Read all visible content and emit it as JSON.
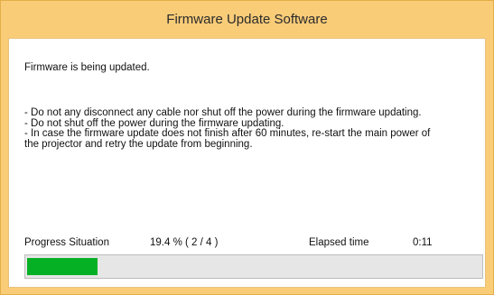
{
  "window": {
    "title": "Firmware Update Software"
  },
  "status": {
    "message": "Firmware is being updated."
  },
  "notes": [
    "- Do not any disconnect any cable nor shut off the power during the firmware updating.",
    "- Do not shut off the power during the firmware updating.",
    "- In case the firmware update does not finish after 60 minutes, re-start the main power of",
    "the projector and retry the update from beginning."
  ],
  "progress": {
    "label": "Progress Situation",
    "value_text": "19.4 % ( 2 / 4 )",
    "fraction": 0.155,
    "bar_color": "#06b025"
  },
  "elapsed": {
    "label": "Elapsed time",
    "value": "0:11"
  },
  "colors": {
    "title_bar": "#f9cc78",
    "track": "#e6e6e6"
  }
}
